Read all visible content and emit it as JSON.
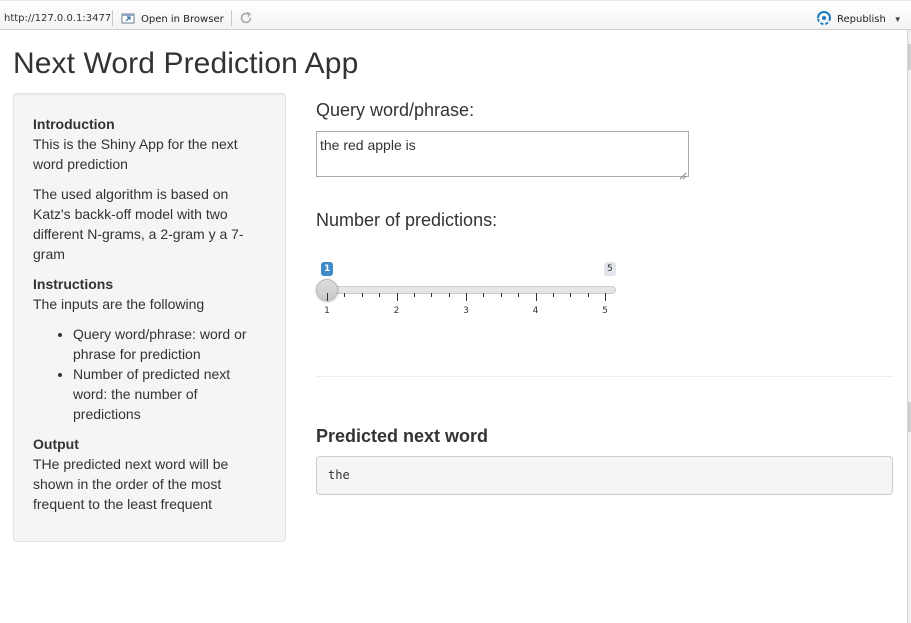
{
  "toolbar": {
    "url": "http://127.0.0.1:3477",
    "open_in_browser": "Open in Browser",
    "republish": "Republish",
    "icons": {
      "open": "open-in-browser-icon",
      "refresh": "refresh-icon",
      "publish": "publish-icon"
    },
    "accent": "#1a7cc1"
  },
  "app": {
    "title": "Next Word Prediction App"
  },
  "sidebar": {
    "intro_heading": "Introduction",
    "intro_text": "This is the Shiny App for the next word prediction",
    "algorithm_text": "The used algorithm is based on Katz's backk-off model with two different N-grams, a 2-gram y a 7-gram",
    "instructions_heading": "Instructions",
    "instructions_text": "The inputs are the following",
    "instructions_items": [
      "Query word/phrase: word or phrase for prediction",
      "Number of predicted next word: the number of predictions"
    ],
    "output_heading": "Output",
    "output_text": "THe predicted next word will be shown in the order of the most frequent to the least frequent"
  },
  "main": {
    "query_label": "Query word/phrase:",
    "query_value": "the red apple is",
    "num_label": "Number of predictions:",
    "slider": {
      "value": 1,
      "min": 1,
      "max": 5,
      "value_label": "1",
      "max_label": "5",
      "tick_labels": [
        "1",
        "2",
        "3",
        "4",
        "5"
      ],
      "color": "#428bca"
    },
    "prediction_label": "Predicted next word",
    "prediction_value": "the"
  }
}
